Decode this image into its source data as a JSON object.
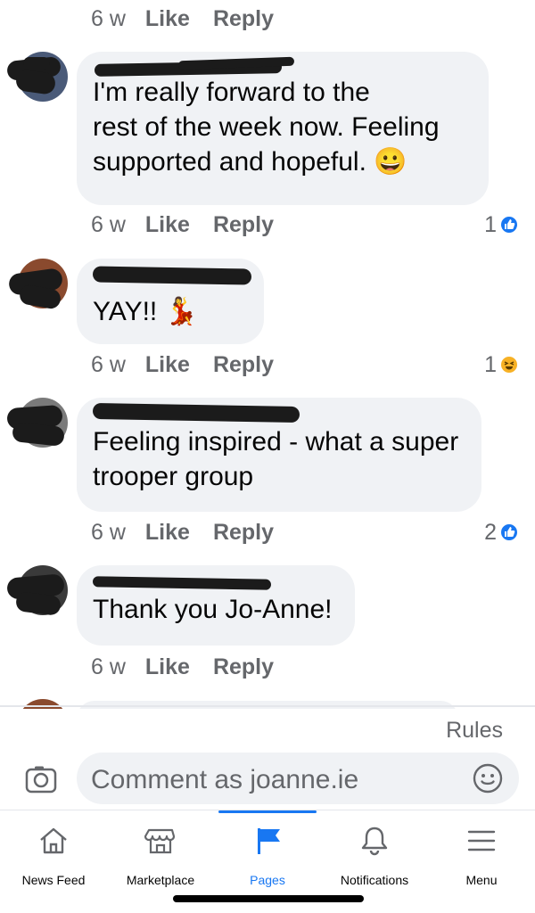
{
  "comments": [
    {
      "time": "6 w",
      "like": "Like",
      "reply": "Reply"
    },
    {
      "text_lines": [
        "I'm really forward to the",
        "rest of the week now. Feeling",
        "supported and hopeful. 😀"
      ],
      "time": "6 w",
      "like": "Like",
      "reply": "Reply",
      "reaction_count": "1",
      "reaction_type": "like-icon"
    },
    {
      "text_lines": [
        "YAY!! 💃"
      ],
      "time": "6 w",
      "like": "Like",
      "reply": "Reply",
      "reaction_count": "1",
      "reaction_type": "haha-icon"
    },
    {
      "text_lines": [
        "Feeling inspired - what a super",
        "trooper group"
      ],
      "time": "6 w",
      "like": "Like",
      "reply": "Reply",
      "reaction_count": "2",
      "reaction_type": "like-icon"
    },
    {
      "text_lines": [
        "Thank you Jo-Anne!"
      ],
      "time": "6 w",
      "like": "Like",
      "reply": "Reply"
    }
  ],
  "rules_label": "Rules",
  "composer": {
    "placeholder": "Comment as joanne.ie"
  },
  "tabs": [
    {
      "label": "News Feed",
      "icon": "home-icon"
    },
    {
      "label": "Marketplace",
      "icon": "marketplace-icon"
    },
    {
      "label": "Pages",
      "icon": "flag-icon",
      "active": true
    },
    {
      "label": "Notifications",
      "icon": "bell-icon"
    },
    {
      "label": "Menu",
      "icon": "menu-icon"
    }
  ],
  "colors": {
    "accent": "#1877f2",
    "bubble": "#f0f2f5",
    "meta": "#65676b",
    "haha": "#f7b125"
  }
}
